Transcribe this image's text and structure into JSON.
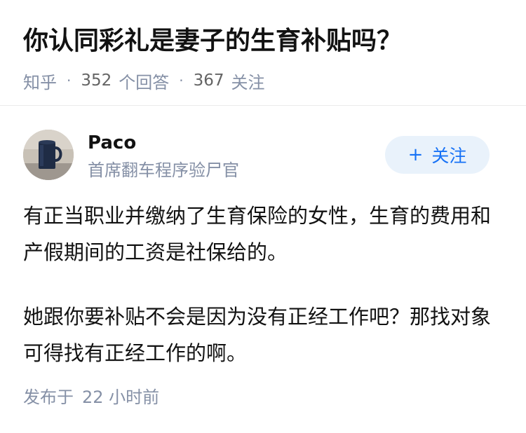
{
  "question": {
    "title": "你认同彩礼是妻子的生育补贴吗？",
    "source": "知乎",
    "separator": "·",
    "answers_count": "352",
    "answers_label": "个回答",
    "followers_count": "367",
    "followers_label": "关注"
  },
  "answer": {
    "author": {
      "name": "Paco",
      "bio": "首席翻车程序验尸官",
      "avatar": "avatar-photo"
    },
    "follow_button": {
      "icon": "plus-icon",
      "icon_glyph": "+",
      "label": "关注"
    },
    "paragraphs": [
      "有正当职业并缴纳了生育保险的女性，生育的费用和产假期间的工资是社保给的。",
      "她跟你要补贴不会是因为没有正经工作吧？那找对象可得找有正经工作的啊。"
    ],
    "published_label": "发布于",
    "published_time": "22 小时前"
  },
  "colors": {
    "text_primary": "#121212",
    "text_secondary": "#8590a6",
    "accent": "#1772f6",
    "button_bg": "#e9f2fb",
    "divider": "#ebebeb"
  }
}
